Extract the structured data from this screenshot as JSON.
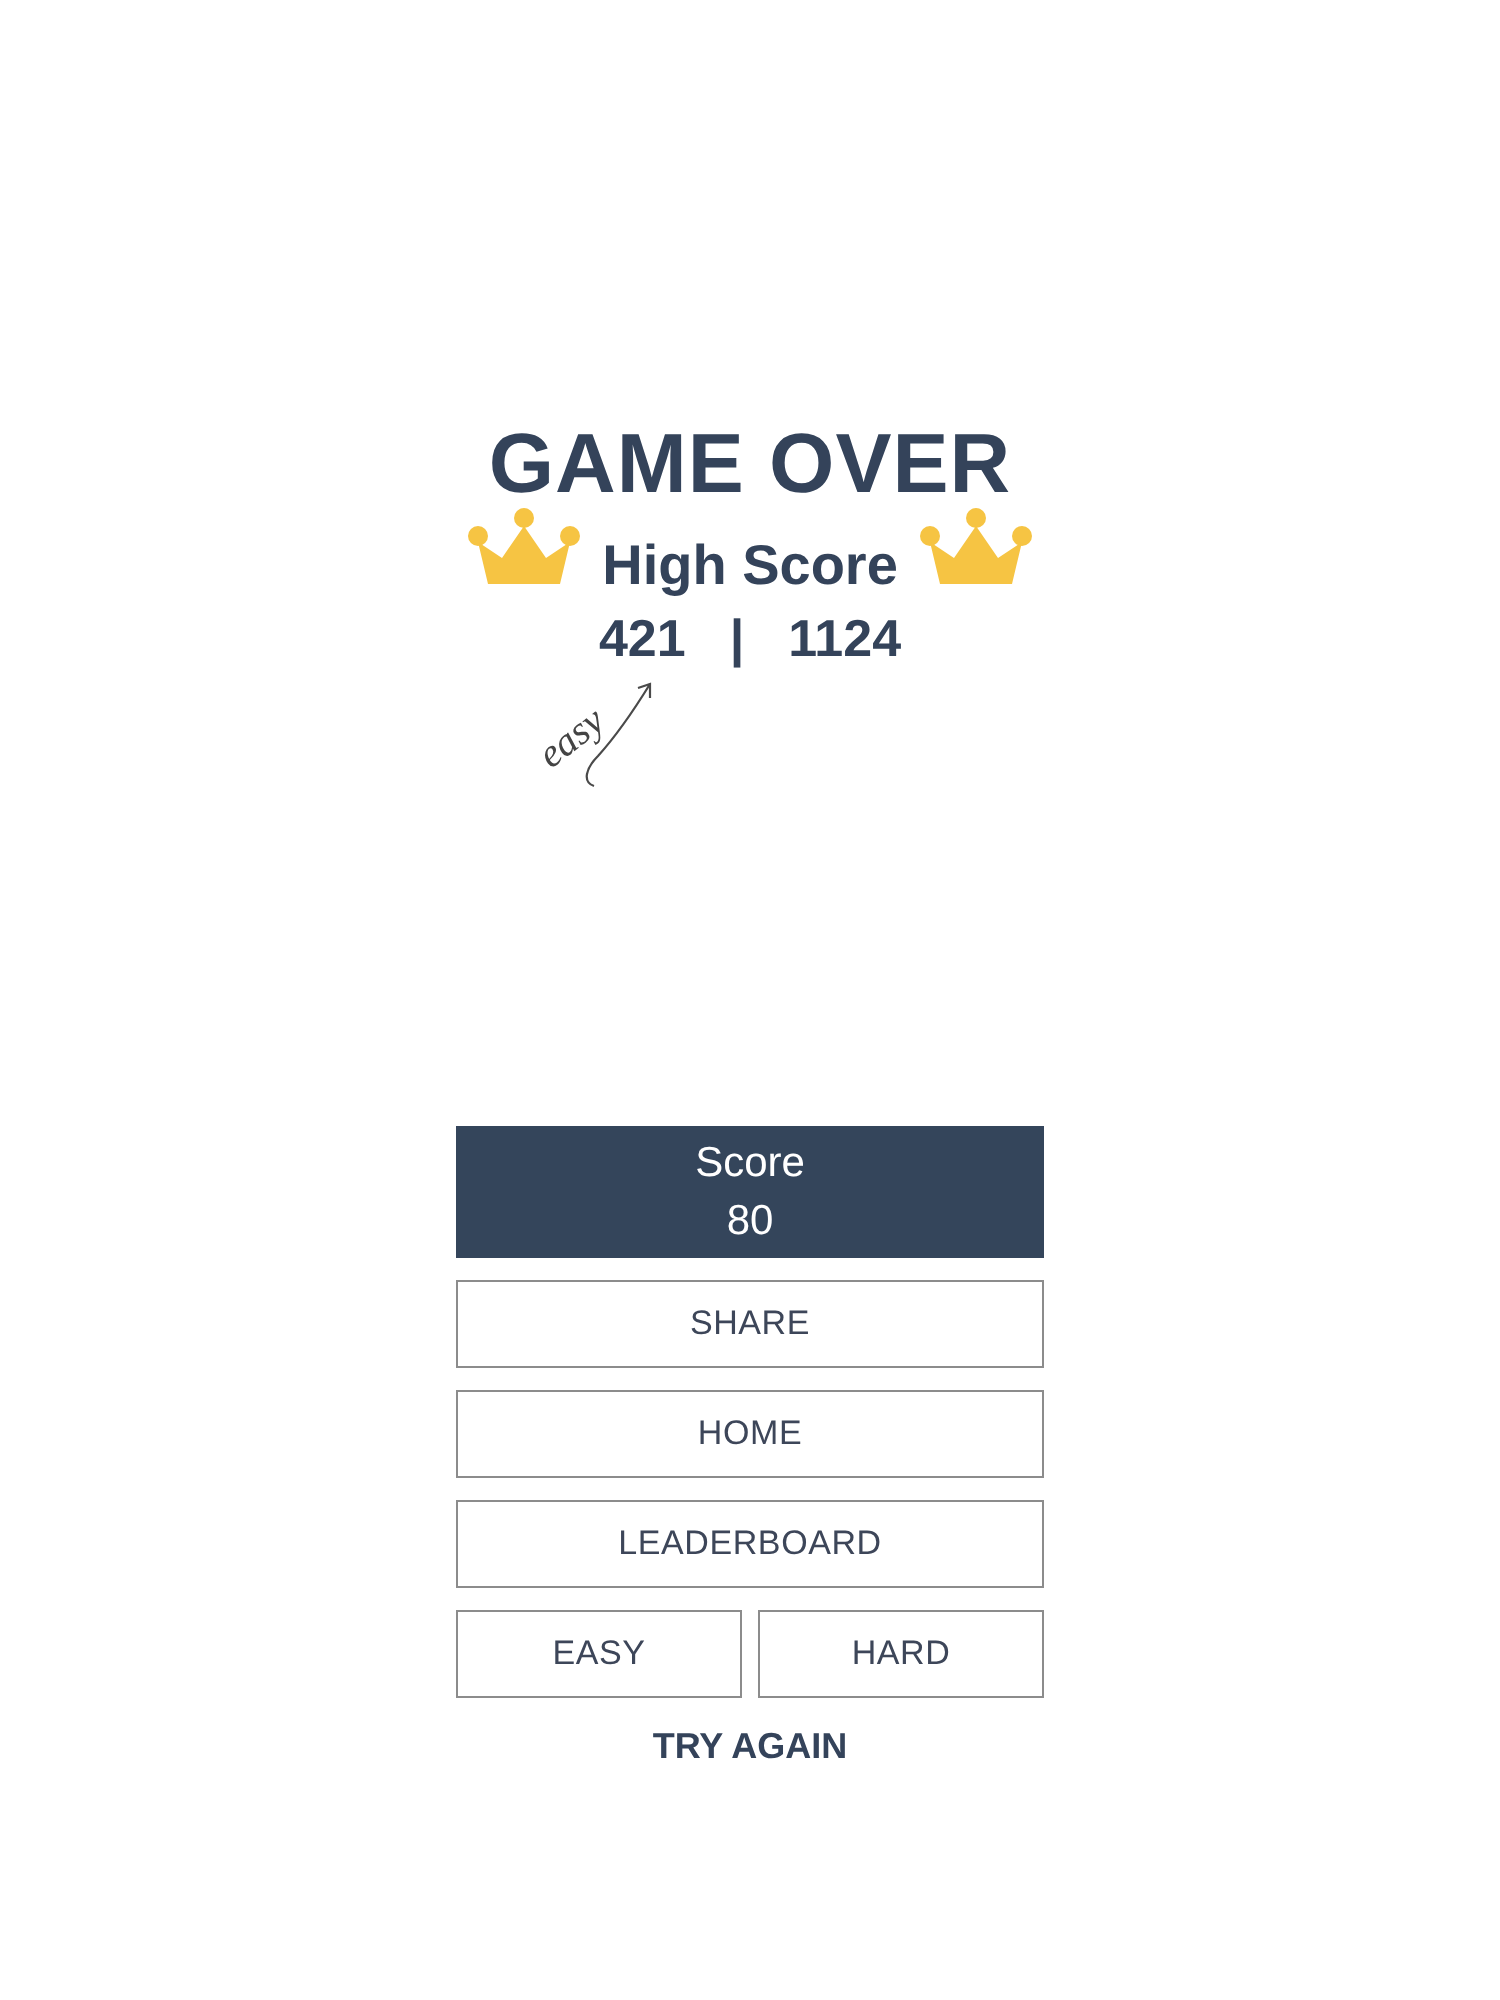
{
  "title": "GAME OVER",
  "high_score": {
    "label": "High Score",
    "values": [
      "421",
      "1124"
    ],
    "separator": "|"
  },
  "annotation": {
    "text": "easy"
  },
  "score_panel": {
    "label": "Score",
    "value": "80"
  },
  "buttons": [
    {
      "label": "SHARE"
    },
    {
      "label": "HOME"
    },
    {
      "label": "LEADERBOARD"
    }
  ],
  "difficulty_buttons": [
    {
      "label": "EASY"
    },
    {
      "label": "HARD"
    }
  ],
  "footer_label": "TRY AGAIN"
}
